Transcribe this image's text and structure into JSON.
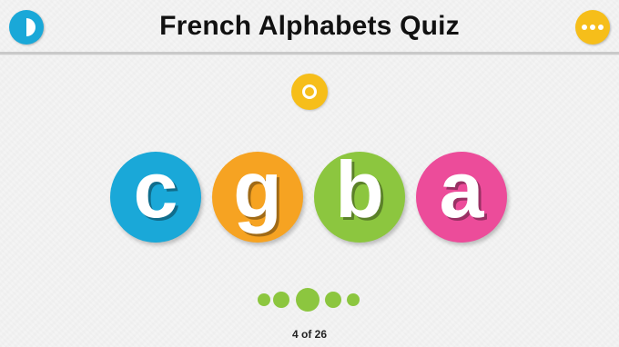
{
  "header": {
    "title": "French Alphabets Quiz"
  },
  "icons": {
    "back": "half-circle-icon",
    "menu": "more-dots-icon",
    "sound": "sound-ring-icon"
  },
  "colors": {
    "blue": "#1aa8d8",
    "orange": "#f6a322",
    "green": "#8cc63f",
    "pink": "#ec4c9a",
    "yellow": "#f6be1a"
  },
  "choices": [
    {
      "letter": "c",
      "color": "#1aa8d8"
    },
    {
      "letter": "g",
      "color": "#f6a322"
    },
    {
      "letter": "b",
      "color": "#8cc63f"
    },
    {
      "letter": "a",
      "color": "#ec4c9a"
    }
  ],
  "progress": {
    "label": "4 of 26",
    "current": 4,
    "total": 26
  }
}
